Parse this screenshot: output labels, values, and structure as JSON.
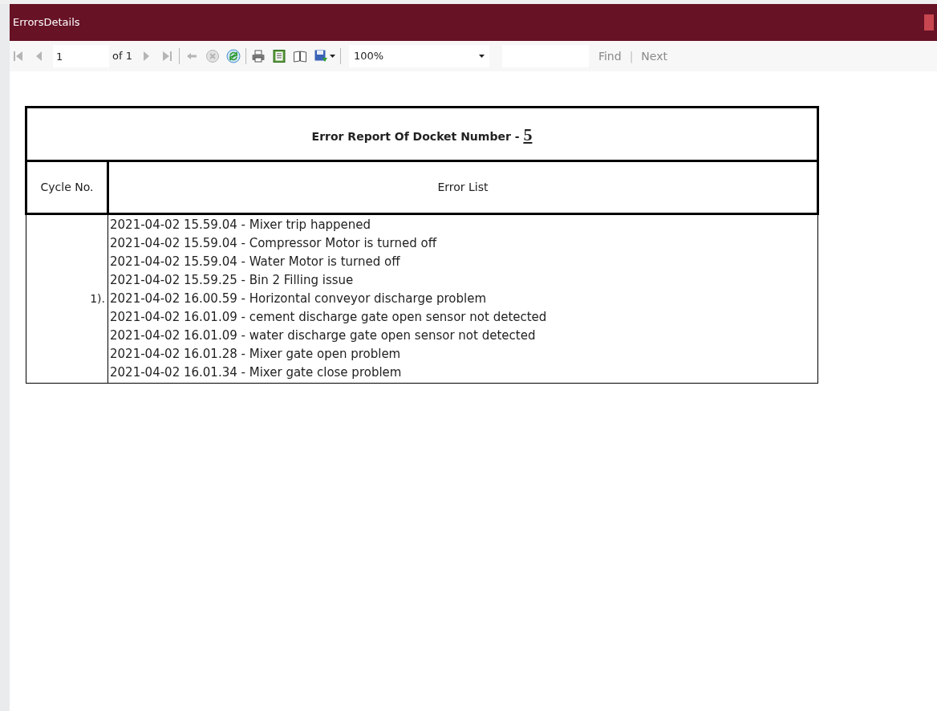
{
  "window": {
    "title": "ErrorsDetails"
  },
  "toolbar": {
    "nav_buttons": [
      {
        "kind": "first",
        "disabled": true
      },
      {
        "kind": "previous",
        "disabled": true
      }
    ],
    "page_field": {
      "value": "1"
    },
    "page_count": "of 1",
    "nav_buttons_after": [
      {
        "kind": "next",
        "disabled": true
      },
      {
        "kind": "last",
        "disabled": true
      }
    ],
    "action_buttons": [
      {
        "kind": "back",
        "disabled": true
      },
      {
        "kind": "stop",
        "disabled": true
      },
      {
        "kind": "refresh",
        "disabled": false
      }
    ],
    "output_buttons": [
      {
        "kind": "print"
      },
      {
        "kind": "layout"
      },
      {
        "kind": "page-setup"
      },
      {
        "kind": "export"
      }
    ],
    "zoom": {
      "value": "100%"
    },
    "find_links": [
      {
        "label": "Find",
        "disabled": true
      },
      {
        "label": "Next",
        "disabled": true
      }
    ],
    "find_separator": "|"
  },
  "report": {
    "title": "Error Report Of Docket Number - ",
    "docket_number": "5",
    "columns": [
      "Cycle No.",
      "Error List"
    ],
    "rows": [
      {
        "cycle": "1).",
        "errors": [
          "2021-04-02 15.59.04 - Mixer trip happened",
          "2021-04-02 15.59.04 - Compressor Motor is turned off",
          "2021-04-02 15.59.04 - Water Motor is turned off",
          "2021-04-02 15.59.25 - Bin 2 Filling issue",
          "2021-04-02 16.00.59 - Horizontal conveyor discharge problem",
          "2021-04-02 16.01.09 - cement discharge gate open sensor not detected",
          "2021-04-02 16.01.09 - water discharge gate open sensor not detected",
          "2021-04-02 16.01.28 - Mixer gate open problem",
          "2021-04-02 16.01.34 - Mixer gate close problem"
        ]
      }
    ]
  }
}
